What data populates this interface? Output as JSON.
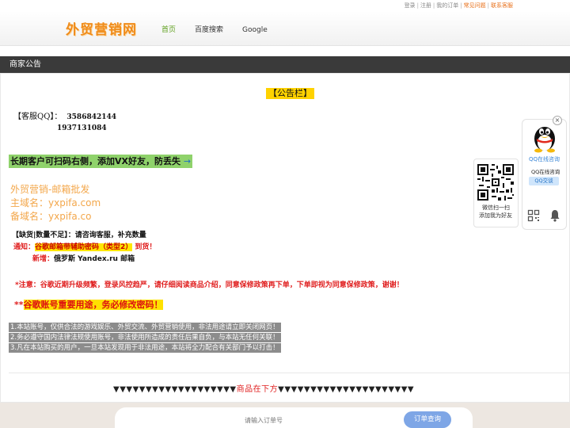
{
  "toplinks": {
    "login": "登录",
    "register": "注册",
    "orders": "我的订单",
    "faq": "常见问题",
    "contact": "联系客服"
  },
  "header": {
    "logo": "外贸营销网",
    "nav": [
      "首页",
      "百度搜索",
      "Google"
    ]
  },
  "section_title": "商家公告",
  "notice": {
    "title": "【公告栏】",
    "qq_label": "【客服QQ】：",
    "qq1": "3586842144",
    "qq2": "1937131084",
    "vx_line": "长期客户可扫码右侧，添加VX好友，防丢失",
    "vx_arrow": "→",
    "mail_title": "外贸营销-邮箱批发",
    "domain1": "主域名：yxpifa.com",
    "domain2": "备域名：yxpifa.co",
    "missing": "【缺货|数量不足】：请咨询客服，补充数量",
    "note_prefix": "通知：",
    "note_highlight": "谷歌邮箱带辅助密码（类型2）",
    "note_suffix": "到货！",
    "new_label": "新增：",
    "new_text": "俄罗斯 Yandex.ru 邮箱",
    "warn1": "*注意：谷歌近期升级频繁，登录风控趋严，请仔细阅读商品介绍，同意保修政策再下单，下单即视为同意保修政策，谢谢！",
    "warn2_prefix": "**",
    "warn2_highlight": "谷歌账号重要用途，务必修改密码！",
    "rules": [
      "1.本站账号，仅供合法的游戏娱乐、外贸交流、外贸营销使用，非法用途请立即关闭网页！",
      "2.务必遵守国内法律法规使用账号，非法使用所造成的责任后果自负，与本站无任何关联！",
      "3.凡在本站购买的用户，一旦本站发现用于非法用途，本站将全力配合有关部门予以打击！"
    ],
    "below_arrows_left": "▼▼▼▼▼▼▼▼▼▼▼▼▼▼▼▼▼▼▼",
    "below_text": "商品在下方",
    "below_arrows_right": "▼▼▼▼▼▼▼▼▼▼▼▼▼▼▼▼▼▼▼▼▼"
  },
  "search": {
    "placeholder": "请输入订单号",
    "button": "订单查询"
  },
  "float": {
    "online": "QQ在线咨询",
    "online2": "QQ在线咨询",
    "chat": "QQ交谈",
    "close": "×",
    "qr_text1": "微信扫一扫",
    "qr_text2": "添加我为好友"
  },
  "colors": {
    "accent_orange": "#f08c1a",
    "nav_active": "#5fa01e",
    "dark_bar": "#3a3a3a",
    "warn_red": "#e02020",
    "button_blue": "#7ea6e6"
  }
}
